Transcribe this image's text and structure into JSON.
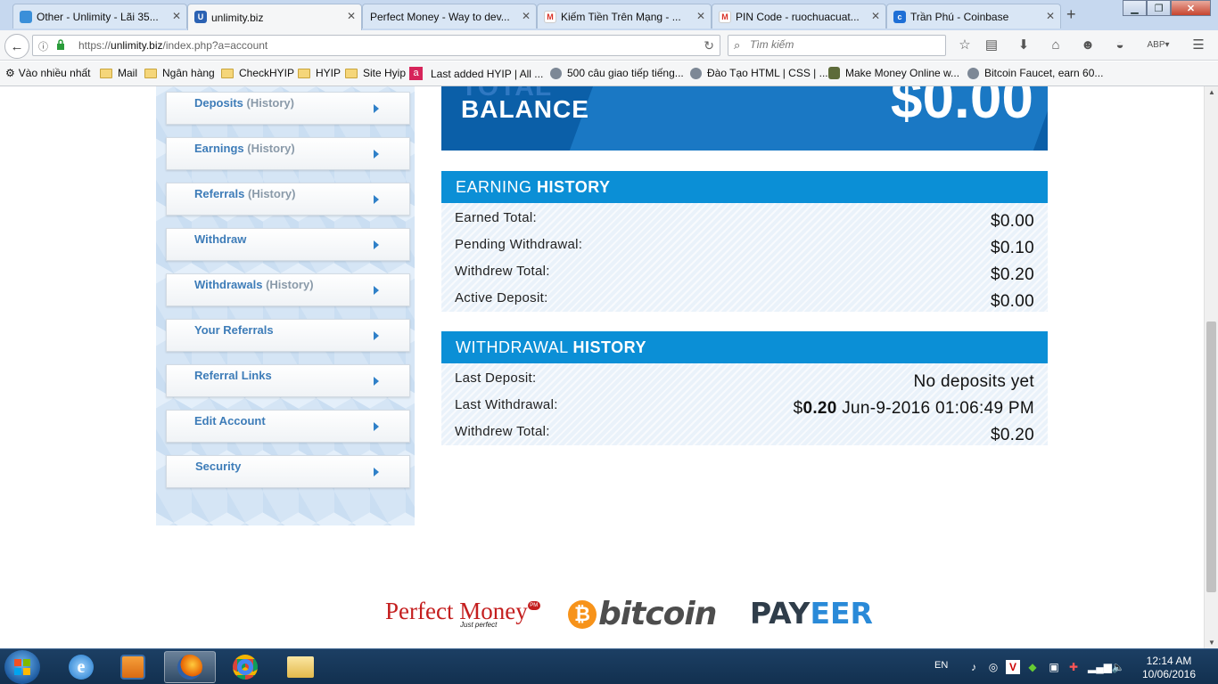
{
  "browser": {
    "tabs": [
      {
        "label": "Other - Unlimity - Lãi 35...",
        "color": "#3a8fd9"
      },
      {
        "label": "unlimity.biz",
        "color": "#2b62b3"
      },
      {
        "label": "Perfect Money - Way to dev...",
        "color": ""
      },
      {
        "label": "Kiếm Tiền Trên Mạng - ...",
        "color": "#d93025"
      },
      {
        "label": "PIN Code - ruochuacuat...",
        "color": "#d93025"
      },
      {
        "label": "Trần Phú - Coinbase",
        "color": "#1e6fd6"
      }
    ],
    "url_prefix": "https://",
    "url_domain": "unlimity.biz",
    "url_path": "/index.php?a=account",
    "search_placeholder": "Tìm kiếm",
    "bookmarks": [
      {
        "label": "Vào nhiều nhất",
        "icon": "gear-icon"
      },
      {
        "label": "Mail",
        "icon": "folder-icon"
      },
      {
        "label": "Ngân hàng",
        "icon": "folder-icon"
      },
      {
        "label": "CheckHYIP",
        "icon": "folder-icon"
      },
      {
        "label": "HYIP",
        "icon": "folder-icon"
      },
      {
        "label": "Site Hyip",
        "icon": "folder-icon"
      },
      {
        "label": "Last added HYIP | All ...",
        "icon": "site-icon"
      },
      {
        "label": "500 câu giao tiếp tiếng...",
        "icon": "globe-icon"
      },
      {
        "label": "Đào Tạo HTML | CSS | ...",
        "icon": "globe-icon"
      },
      {
        "label": "Make Money Online w...",
        "icon": "site-icon"
      },
      {
        "label": "Bitcoin Faucet, earn 60...",
        "icon": "globe-icon"
      }
    ]
  },
  "sidebar": {
    "items": [
      {
        "label": "Deposits",
        "suffix": "(History)"
      },
      {
        "label": "Earnings",
        "suffix": "(History)"
      },
      {
        "label": "Referrals",
        "suffix": "(History)"
      },
      {
        "label": "Withdraw",
        "suffix": ""
      },
      {
        "label": "Withdrawals",
        "suffix": "(History)"
      },
      {
        "label": "Your Referrals",
        "suffix": ""
      },
      {
        "label": "Referral Links",
        "suffix": ""
      },
      {
        "label": "Edit Account",
        "suffix": ""
      },
      {
        "label": "Security",
        "suffix": ""
      }
    ]
  },
  "balance": {
    "ghost_label": "TOTAL",
    "label": "BALANCE",
    "amount": "$0.00"
  },
  "earning_history": {
    "title_light": "EARNING ",
    "title_bold": "HISTORY",
    "rows": [
      {
        "key": "Earned Total:",
        "value": "$0.00"
      },
      {
        "key": "Pending Withdrawal:",
        "value": "$0.10"
      },
      {
        "key": "Withdrew Total:",
        "value": "$0.20"
      },
      {
        "key": "Active Deposit:",
        "value": "$0.00"
      }
    ]
  },
  "withdrawal_history": {
    "title_light": "WITHDRAWAL ",
    "title_bold": "HISTORY",
    "last_deposit_label": "Last Deposit:",
    "last_deposit_value": "No deposits yet",
    "last_withdrawal_label": "Last Withdrawal:",
    "last_withdrawal_currency": "$",
    "last_withdrawal_amount": "0.20",
    "last_withdrawal_date": " Jun-9-2016 01:06:49 PM",
    "withdrew_total_label": "Withdrew Total:",
    "withdrew_total_value": "$0.20"
  },
  "payment_logos": {
    "perfect_money": "Perfect Money",
    "perfect_money_tagline": "Just perfect",
    "perfect_money_badge": "PM",
    "bitcoin": "bitcoin",
    "payeer_a": "PAY",
    "payeer_b": "EER"
  },
  "taskbar": {
    "lang": "EN",
    "time": "12:14 AM",
    "date": "10/06/2016"
  },
  "colors": {
    "accent": "#0b8fd6",
    "balance_bg": "#0b5fa8",
    "menu_text": "#3d7cb8"
  }
}
